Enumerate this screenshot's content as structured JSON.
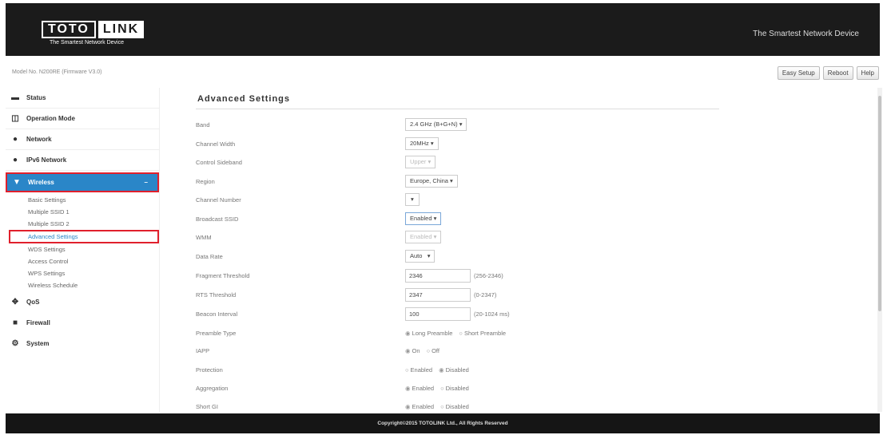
{
  "header": {
    "logo_left": "TOTO",
    "logo_right": "LINK",
    "logo_tag": "The Smartest Network Device",
    "tagline": "The Smartest Network Device"
  },
  "model_line": "Model No. N200RE (Firmware V3.0)",
  "top_buttons": {
    "easy_setup": "Easy Setup",
    "reboot": "Reboot",
    "help": "Help"
  },
  "sidebar": {
    "status": "Status",
    "operation_mode": "Operation Mode",
    "network": "Network",
    "ipv6_network": "IPv6 Network",
    "wireless": "Wireless",
    "wireless_items": [
      "Basic Settings",
      "Multiple SSID 1",
      "Multiple SSID 2",
      "Advanced Settings",
      "WDS Settings",
      "Access Control",
      "WPS Settings",
      "Wireless Schedule"
    ],
    "qos": "QoS",
    "firewall": "Firewall",
    "system": "System"
  },
  "main": {
    "title": "Advanced Settings",
    "band": {
      "label": "Band",
      "value": "2.4 GHz (B+G+N)"
    },
    "channel_width": {
      "label": "Channel Width",
      "value": "20MHz"
    },
    "control_sideband": {
      "label": "Control Sideband",
      "value": "Upper"
    },
    "region": {
      "label": "Region",
      "value": "Europe, China"
    },
    "channel_number": {
      "label": "Channel Number",
      "value": ""
    },
    "broadcast_ssid": {
      "label": "Broadcast SSID",
      "value": "Enabled"
    },
    "wmm": {
      "label": "WMM",
      "value": "Enabled"
    },
    "data_rate": {
      "label": "Data Rate",
      "value": "Auto"
    },
    "fragment_threshold": {
      "label": "Fragment Threshold",
      "value": "2346",
      "hint": "(256-2346)"
    },
    "rts_threshold": {
      "label": "RTS Threshold",
      "value": "2347",
      "hint": "(0-2347)"
    },
    "beacon_interval": {
      "label": "Beacon Interval",
      "value": "100",
      "hint": "(20-1024 ms)"
    },
    "preamble_type": {
      "label": "Preamble Type",
      "opt1": "Long Preamble",
      "opt2": "Short Preamble"
    },
    "iapp": {
      "label": "IAPP",
      "opt1": "On",
      "opt2": "Off"
    },
    "protection": {
      "label": "Protection",
      "opt1": "Enabled",
      "opt2": "Disabled"
    },
    "aggregation": {
      "label": "Aggregation",
      "opt1": "Enabled",
      "opt2": "Disabled"
    },
    "short_gi": {
      "label": "Short GI",
      "opt1": "Enabled",
      "opt2": "Disabled"
    }
  },
  "footer": "Copyright©2015 TOTOLINK Ltd., All Rights Reserved",
  "colors": {
    "header_bg": "#1b1b1b",
    "accent": "#2a86c8",
    "highlight_border": "#e0202c"
  }
}
